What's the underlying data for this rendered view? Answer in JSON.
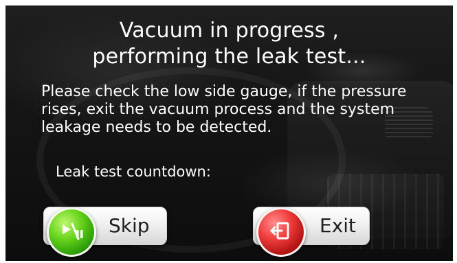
{
  "screen": {
    "title": "Vacuum in progress ,\nperforming the leak test...",
    "message": "Please check the low side gauge, if the pressure\nrises, exit the vacuum process and the system\nleakage needs to be detected.",
    "countdown_label": "Leak test countdown:"
  },
  "buttons": {
    "skip": {
      "label": "Skip",
      "icon": "play-pause-icon",
      "color": "#4fc21a"
    },
    "exit": {
      "label": "Exit",
      "icon": "exit-door-icon",
      "color": "#d82a2a"
    }
  }
}
